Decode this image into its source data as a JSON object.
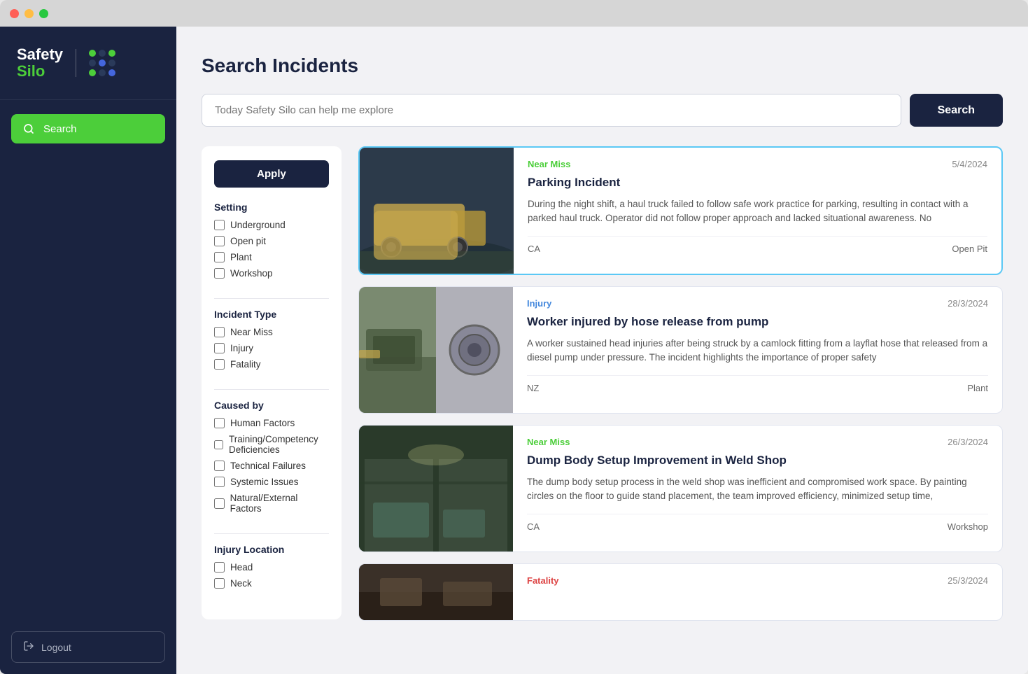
{
  "window": {
    "title": "Safety Silo"
  },
  "sidebar": {
    "logo_text_safety": "Safety",
    "logo_text_silo": "Silo",
    "nav_items": [
      {
        "id": "search",
        "label": "Search",
        "active": true
      }
    ],
    "logout_label": "Logout"
  },
  "main": {
    "page_title": "Search Incidents",
    "search_placeholder": "Today Safety Silo can help me explore",
    "search_button_label": "Search"
  },
  "filters": {
    "apply_label": "Apply",
    "sections": [
      {
        "title": "Setting",
        "options": [
          "Underground",
          "Open pit",
          "Plant",
          "Workshop"
        ]
      },
      {
        "title": "Incident Type",
        "options": [
          "Near Miss",
          "Injury",
          "Fatality"
        ]
      },
      {
        "title": "Caused by",
        "options": [
          "Human Factors",
          "Training/Competency Deficiencies",
          "Technical Failures",
          "Systemic Issues",
          "Natural/External Factors"
        ]
      },
      {
        "title": "Injury Location",
        "options": [
          "Head",
          "Neck"
        ]
      }
    ]
  },
  "incidents": [
    {
      "id": 1,
      "type": "Near Miss",
      "type_class": "badge-nearmiss",
      "date": "5/4/2024",
      "title": "Parking Incident",
      "description": "During the night shift, a haul truck failed to follow safe work practice for parking, resulting in contact with a parked haul truck. Operator did not follow proper approach and lacked situational awareness. No",
      "location": "CA",
      "setting": "Open Pit",
      "highlighted": true,
      "image_class": "img-parking"
    },
    {
      "id": 2,
      "type": "Injury",
      "type_class": "badge-injury",
      "date": "28/3/2024",
      "title": "Worker injured by hose release from pump",
      "description": "A worker sustained head injuries after being struck by a camlock fitting from a layflat hose that released from a diesel pump under pressure. The incident highlights the importance of proper safety",
      "location": "NZ",
      "setting": "Plant",
      "highlighted": false,
      "image_class": "img-hose"
    },
    {
      "id": 3,
      "type": "Near Miss",
      "type_class": "badge-nearmiss",
      "date": "26/3/2024",
      "title": "Dump Body Setup Improvement in Weld Shop",
      "description": "The dump body setup process in the weld shop was inefficient and compromised work space. By painting circles on the floor to guide stand placement, the team improved efficiency, minimized setup time,",
      "location": "CA",
      "setting": "Workshop",
      "highlighted": false,
      "image_class": "img-weld"
    },
    {
      "id": 4,
      "type": "Fatality",
      "type_class": "badge-fatality",
      "date": "25/3/2024",
      "title": "",
      "description": "",
      "location": "",
      "setting": "",
      "highlighted": false,
      "image_class": "img-fatality"
    }
  ]
}
